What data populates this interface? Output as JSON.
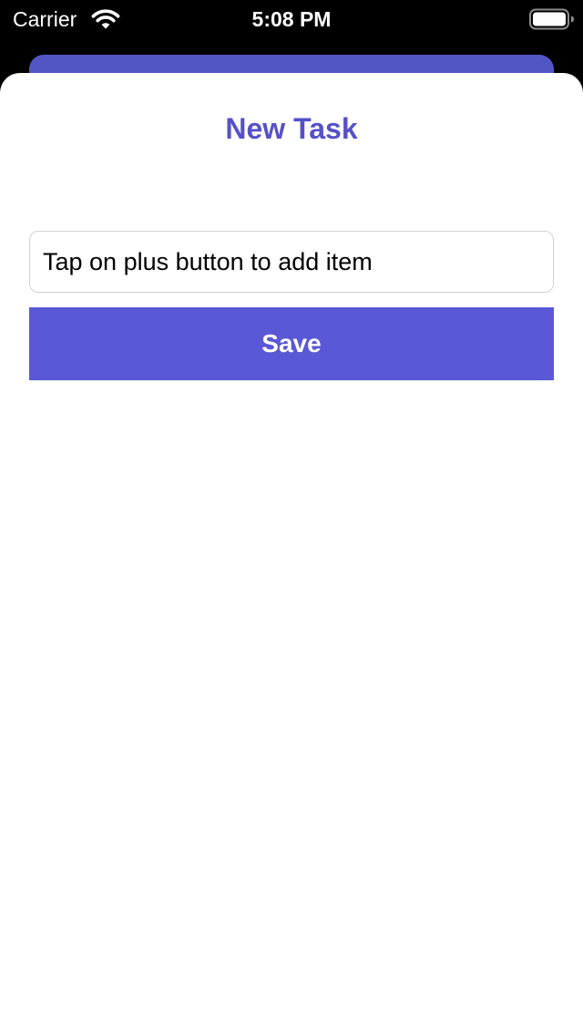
{
  "status_bar": {
    "carrier": "Carrier",
    "time": "5:08 PM",
    "wifi_icon": "wifi-icon",
    "battery_icon": "battery-icon",
    "battery_level": 1.0
  },
  "sheet": {
    "title": "New Task",
    "task_input": {
      "value": "",
      "placeholder": "Tap on plus button to add item"
    },
    "save_label": "Save"
  },
  "colors": {
    "accent": "#5a58d6",
    "title": "#5650c8",
    "background_card": "#5256c5"
  }
}
